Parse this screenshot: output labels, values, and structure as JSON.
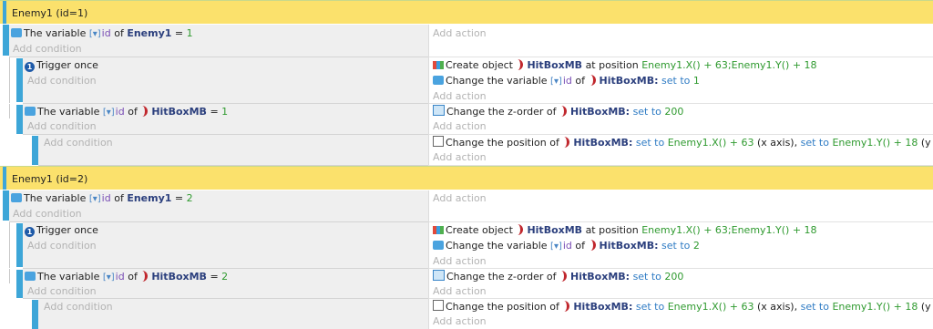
{
  "common": {
    "add_condition": "Add condition",
    "add_action": "Add action",
    "the_variable": "The variable",
    "var_name": "id",
    "of": "of",
    "equals": "=",
    "trigger_once": "Trigger once",
    "create_object": "Create object",
    "at_position": "at position",
    "change_variable": "Change the variable",
    "change_zorder": "Change the z-order of",
    "change_position": "Change the position of",
    "set_to": "set to",
    "x_axis": "(x axis),",
    "y_axis": "(y axis)",
    "hitbox": "HitBoxMB",
    "hitbox_colon": "HitBoxMB:",
    "enemy": "Enemy1",
    "create_pos": "Enemy1.X() + 63;Enemy1.Y() + 18",
    "pos_x": "Enemy1.X() + 63",
    "pos_y": "Enemy1.Y() + 18",
    "zorder_value": "200"
  },
  "groups": [
    {
      "title": "Enemy1 (id=1)",
      "id_value": "1"
    },
    {
      "title": "Enemy1 (id=2)",
      "id_value": "2"
    }
  ],
  "colors": {
    "group_bg": "#fbe16c",
    "accent_bar": "#3da6d8",
    "condition_bg": "#efefef",
    "keyword_blue": "#2e7bc4",
    "value_green": "#2f9a2f"
  }
}
